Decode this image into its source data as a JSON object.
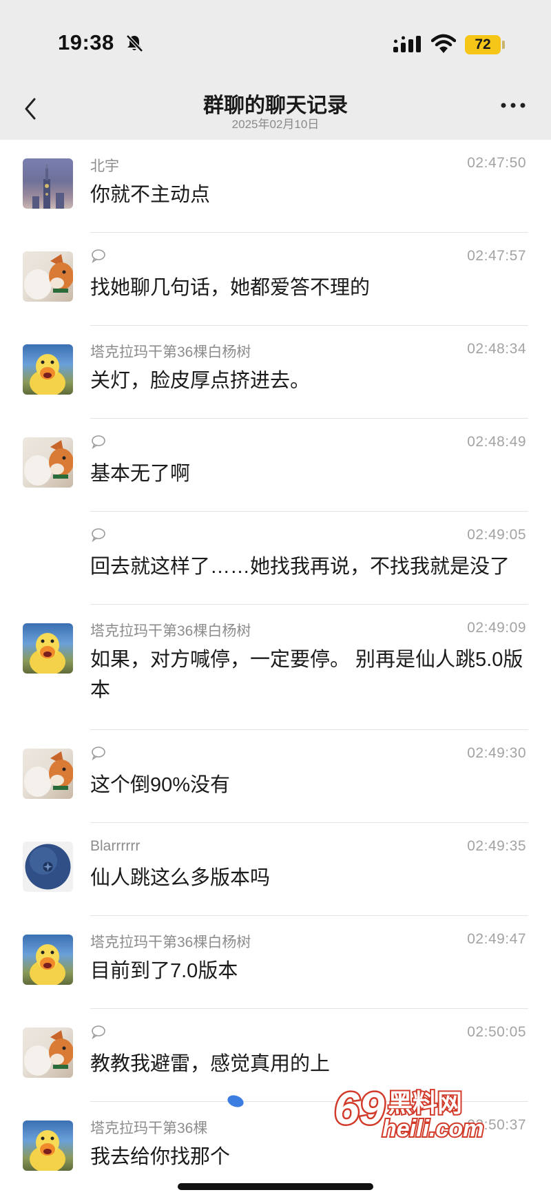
{
  "status_bar": {
    "time": "19:38",
    "battery": "72",
    "icons": [
      "bell-slash-icon",
      "cellular-signal-icon",
      "wifi-icon",
      "battery-icon"
    ]
  },
  "nav": {
    "title": "群聊的聊天记录",
    "subtitle": "2025年02月10日",
    "icons": [
      "chevron-left-icon",
      "more-icon"
    ]
  },
  "messages": [
    {
      "sender": "北宇",
      "time": "02:47:50",
      "text": "你就不主动点",
      "avatar": "city-night-avatar"
    },
    {
      "sender": "",
      "time": "02:47:57",
      "text": "找她聊几句话，她都爱答不理的",
      "avatar": "fox-avatar"
    },
    {
      "sender": "塔克拉玛干第36棵白杨树",
      "time": "02:48:34",
      "text": "关灯，脸皮厚点挤进去。",
      "avatar": "duck-avatar"
    },
    {
      "sender": "",
      "time": "02:48:49",
      "text": "基本无了啊",
      "avatar": "fox-avatar"
    },
    {
      "sender": "",
      "time": "02:49:05",
      "text": "回去就这样了……她找我再说，不找我就是没了",
      "avatar": ""
    },
    {
      "sender": "塔克拉玛干第36棵白杨树",
      "time": "02:49:09",
      "text": "如果，对方喊停，一定要停。 别再是仙人跳5.0版本",
      "avatar": "duck-avatar"
    },
    {
      "sender": "",
      "time": "02:49:30",
      "text": "这个倒90%没有",
      "avatar": "fox-avatar"
    },
    {
      "sender": "Blarrrrrr",
      "time": "02:49:35",
      "text": "仙人跳这么多版本吗",
      "avatar": "blueberry-avatar"
    },
    {
      "sender": "塔克拉玛干第36棵白杨树",
      "time": "02:49:47",
      "text": "目前到了7.0版本",
      "avatar": "duck-avatar"
    },
    {
      "sender": "",
      "time": "02:50:05",
      "text": "教教我避雷，感觉真用的上",
      "avatar": "fox-avatar"
    },
    {
      "sender": "塔克拉玛干第36棵",
      "time": "02:50:37",
      "text": "我去给你找那个",
      "avatar": "duck-avatar"
    }
  ],
  "watermark": {
    "line1": "69",
    "line2": "黑料网",
    "line3": "heili.com"
  },
  "colors": {
    "header_bg": "#ececec",
    "battery": "#f5c518",
    "meta_text": "#8c8c8c",
    "watermark": "#d23a2a"
  }
}
